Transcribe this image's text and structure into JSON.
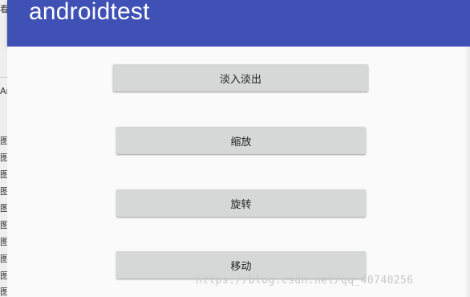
{
  "background_window": {
    "glyphs": [
      "看",
      "Ar",
      "图",
      "图",
      "图",
      "图",
      "图",
      "图",
      "图",
      "图",
      "图",
      "图"
    ]
  },
  "app_bar": {
    "title": "androidtest",
    "color": "#3f51b5"
  },
  "buttons": [
    {
      "label": "淡入淡出"
    },
    {
      "label": "缩放"
    },
    {
      "label": "旋转"
    },
    {
      "label": "移动"
    }
  ],
  "watermark": "https://blog.csdn.net/qq_40740256",
  "colors": {
    "button_bg": "#d6d7d7",
    "content_bg": "#fafafa",
    "title_text": "#ffffff"
  }
}
